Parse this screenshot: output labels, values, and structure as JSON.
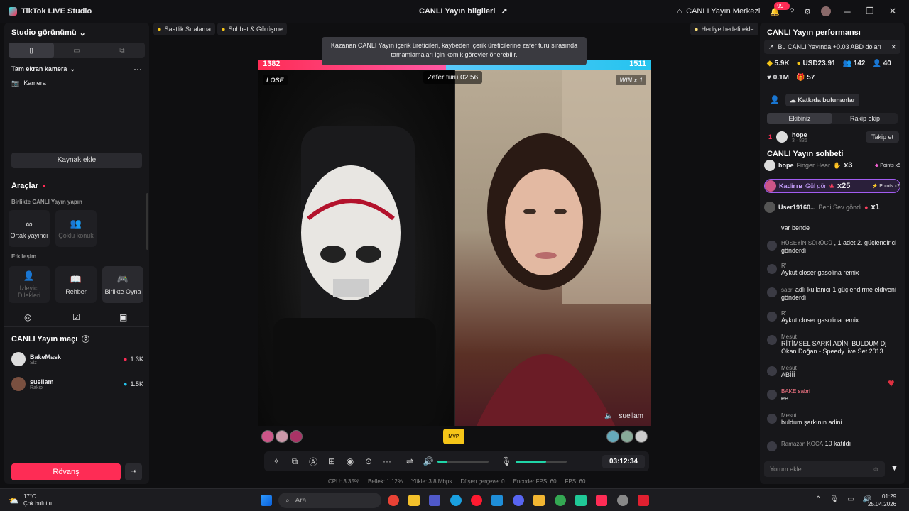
{
  "titlebar": {
    "app_name": "TikTok LIVE Studio",
    "center_title": "CANLI Yayın bilgileri",
    "live_center": "CANLI Yayın Merkezi",
    "notif_badge": "99+"
  },
  "left": {
    "studio_view": "Studio görünümü",
    "fullscreen_camera": "Tam ekran kamera",
    "camera": "Kamera",
    "add_source": "Kaynak ekle",
    "tools_title": "Araçlar",
    "section_live_together": "Birlikte CANLI Yayın yapın",
    "tool_cohost": "Ortak yayıncı",
    "tool_multi_guest": "Çoklu konuk",
    "section_interaction": "Etkileşim",
    "tool_viewer_requests": "İzleyici Dilekleri",
    "tool_guide": "Rehber",
    "tool_play_together": "Birlikte Oyna",
    "match_title": "CANLI Yayın maçı",
    "players": [
      {
        "name": "BakeMask",
        "role": "Siz",
        "score": "1.3K"
      },
      {
        "name": "suellam",
        "role": "Rakip",
        "score": "1.5K"
      }
    ],
    "rematch": "Rövanş"
  },
  "center": {
    "chip_hourly": "Saatlik Sıralama",
    "chip_chat": "Sohbet & Görüşme",
    "chip_gift_goal": "Hediye hedefi ekle",
    "tooltip": "Kazanan CANLI Yayın içerik üreticileri, kaybeden içerik üreticilerine zafer turu sırasında tamamlamaları için komik görevler önerebilir.",
    "score_left": "1382",
    "score_right": "1511",
    "left_share": 0.4776,
    "timer": "Zafer turu 02:56",
    "lose_tag": "LOSE",
    "win_tag": "WIN x 1",
    "opponent_name": "suellam",
    "mvp": "MVP",
    "elapsed": "03:12:34",
    "volume_level": 0.2,
    "mic_level": 0.6
  },
  "stats": {
    "cpu": "CPU: 3.35%",
    "memory": "Bellek: 1.12%",
    "upload": "Yükle: 3.8 Mbps",
    "dropped": "Düşen çerçeve: 0",
    "encoder_fps": "Encoder FPS: 60",
    "fps": "FPS: 60"
  },
  "right": {
    "perf_title": "CANLI Yayın performansı",
    "perf_note": "Bu CANLI Yayında +0.03 ABD doları",
    "stat_coins": "5.9K",
    "stat_usd": "USD23.91",
    "stat_viewers": "142",
    "stat_new": "40",
    "stat_likes": "0.1M",
    "stat_gifts": "57",
    "contributors": "Katkıda bulunanlar",
    "tab_team": "Ekibiniz",
    "tab_rival": "Rakip ekip",
    "top_rank": "1",
    "top_user": "hope",
    "top_user_sub": "3 · 836",
    "follow": "Takip et",
    "chat_title": "CANLI Yayın sohbeti",
    "gifts": [
      {
        "user": "hope",
        "gift": "Finger Hear",
        "mult": "x3",
        "points": "Points x5"
      },
      {
        "user": "Kadirтв",
        "gift": "Gül gör",
        "mult": "x25",
        "points": "Points x2"
      },
      {
        "user": "User19160...",
        "gift": "Beni Sev göndi",
        "mult": "x1",
        "points": ""
      }
    ],
    "messages": [
      {
        "user": "",
        "text": "var bende"
      },
      {
        "user": "HÜSEYİN SÜRÜCÜ",
        "text": ", 1 adet 2. güçlendirici gönderdi"
      },
      {
        "user": "R'",
        "text": "Aykut closer gasolina remix"
      },
      {
        "user": "sabri",
        "text": "adlı kullanıcı 1 güçlendirme eldiveni gönderdi"
      },
      {
        "user": "R'",
        "text": "Aykut closer gasolina remix"
      },
      {
        "user": "Mesut",
        "text": "RİTİMSEL SARKİ ADİNİ BULDUM Dj Okan Doğan - Speedy live Set 2013"
      },
      {
        "user": "Mesut",
        "text": "ABİİİ"
      },
      {
        "user": "BAKE sabri",
        "text": "ee"
      },
      {
        "user": "Mesut",
        "text": "buldum şarkının adini"
      },
      {
        "user": "Ramazan KOCA",
        "text": "10 katıldı"
      }
    ],
    "comment_placeholder": "Yorum ekle"
  },
  "taskbar": {
    "weather_temp": "17°C",
    "weather_desc": "Çok bulutlu",
    "search_placeholder": "Ara",
    "time": "01:29",
    "date": "25.04.2026"
  }
}
